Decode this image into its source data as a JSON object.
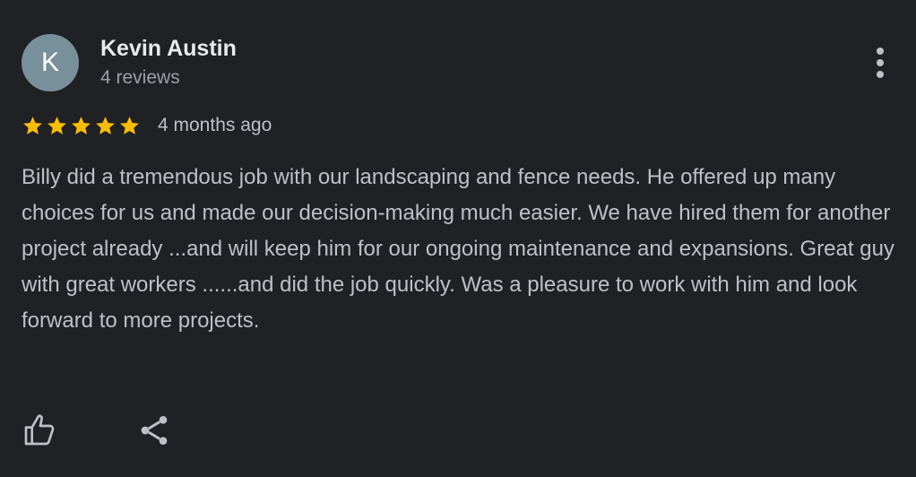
{
  "review": {
    "author": {
      "initial": "K",
      "name": "Kevin Austin",
      "review_count": "4 reviews",
      "avatar_color": "#78909c"
    },
    "rating": 5,
    "rating_max": 5,
    "star_color": "#fbbc04",
    "time_ago": "4 months ago",
    "text": "Billy did a tremendous job with our landscaping and fence needs. He offered up many choices for us and made our decision-making much easier. We have hired them for another project already ...and will keep him for our ongoing maintenance and expansions. Great guy with great workers ......and did the job quickly. Was a pleasure to work with him and look forward to more projects."
  },
  "actions": {
    "like_icon": "thumbs-up-icon",
    "share_icon": "share-icon",
    "more_icon": "more-vertical-icon"
  }
}
